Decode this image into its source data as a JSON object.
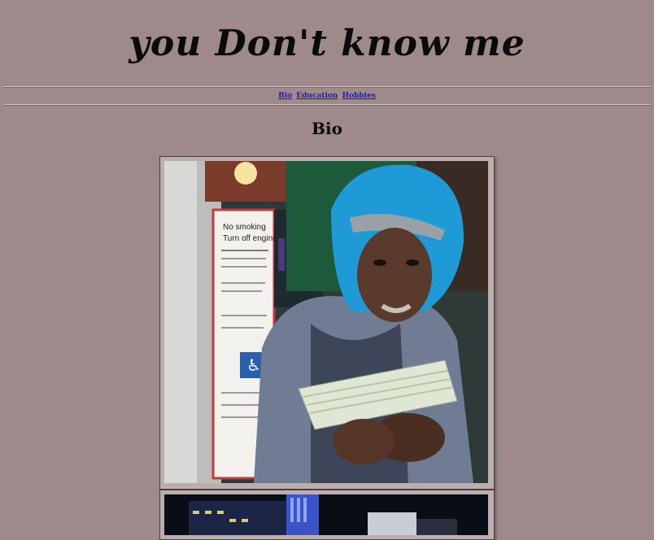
{
  "header": {
    "title": "you Don't know me"
  },
  "nav": {
    "links": [
      {
        "label": "Bio"
      },
      {
        "label": "Education"
      },
      {
        "label": "Hobbies"
      }
    ]
  },
  "main": {
    "heading": "Bio",
    "photo1_sign": {
      "line1": "No smoking",
      "line2": "Turn off engine"
    }
  },
  "colors": {
    "background": "#9e8a8a",
    "link": "#1a1acc",
    "hood": "#1e9bd6"
  }
}
